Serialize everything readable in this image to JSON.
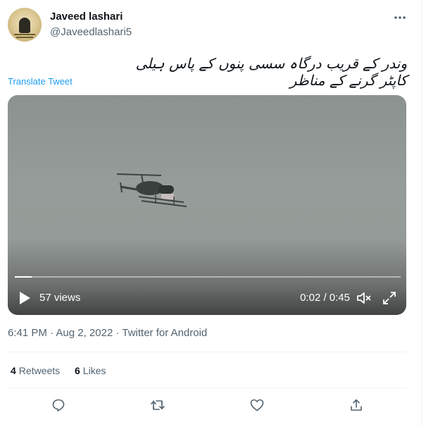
{
  "tweet": {
    "author_name": "Javeed lashari",
    "author_handle": "@Javeedlashari5",
    "text": "وندر کے قریب درگاہ سسی پنوں کے پاس ہیلی کاپٹر گرنے کے مناظر",
    "translate_label": "Translate Tweet",
    "time": "6:41 PM",
    "date": "Aug 2, 2022",
    "source": "Twitter for Android",
    "sep": "·"
  },
  "video": {
    "views": "57 views",
    "time": "0:02 / 0:45",
    "progress": 0.044
  },
  "stats": {
    "retweets_count": "4",
    "retweets_label": "Retweets",
    "likes_count": "6",
    "likes_label": "Likes"
  },
  "icons": {
    "more": "more-dots-icon",
    "reply": "reply-icon",
    "retweet": "retweet-icon",
    "like": "heart-icon",
    "share": "share-icon",
    "play": "play-icon",
    "volume": "volume-icon",
    "fullscreen": "expand-icon"
  },
  "colors": {
    "accent": "#1d9bf0",
    "muted": "#536471",
    "text": "#0f1419"
  }
}
